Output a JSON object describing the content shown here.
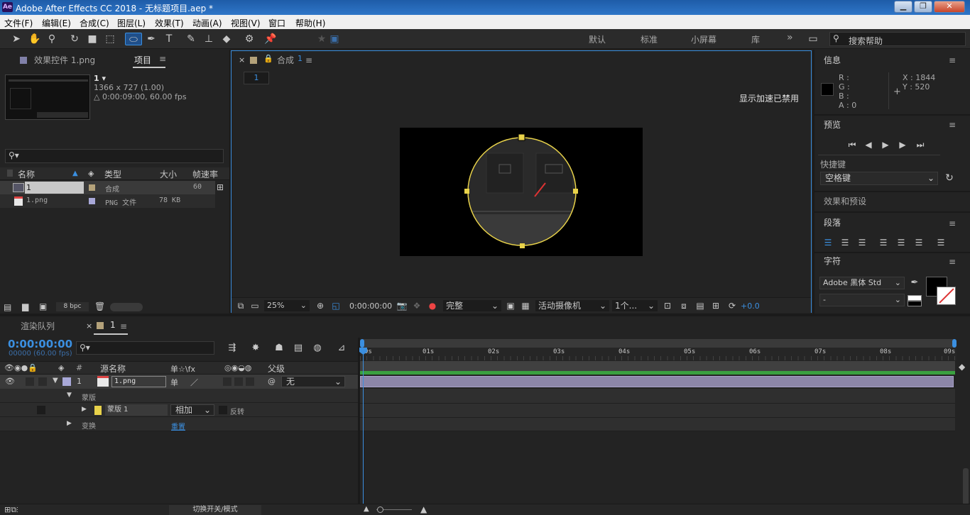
{
  "window": {
    "title": "Adobe After Effects CC 2018 - 无标题项目.aep *",
    "app_badge": "Ae",
    "min": "▁",
    "restore": "❐",
    "close": "✕"
  },
  "menu": [
    "文件(F)",
    "编辑(E)",
    "合成(C)",
    "图层(L)",
    "效果(T)",
    "动画(A)",
    "视图(V)",
    "窗口",
    "帮助(H)"
  ],
  "workspaces": {
    "default": "默认",
    "standard": "标准",
    "small_screen": "小屏幕",
    "library": "库",
    "more": "»"
  },
  "help_search": {
    "placeholder": "搜索帮助"
  },
  "project_panel": {
    "tab_effects": "效果控件 1.png",
    "tab_project": "项目",
    "comp_name": "1 ▾",
    "comp_size": "1366 x 727 (1.00)",
    "comp_duration": "△ 0:00:09:00, 60.00 fps",
    "search_placeholder": "",
    "columns": {
      "name": "名称",
      "type": "类型",
      "size": "大小",
      "fps": "帧速率"
    },
    "items": [
      {
        "name": "1",
        "type": "合成",
        "size": "",
        "fps": "60"
      },
      {
        "name": "1.png",
        "type": "PNG 文件",
        "size": "78 KB",
        "fps": ""
      }
    ],
    "bpc": "8 bpc"
  },
  "comp_panel": {
    "tab": "合成",
    "tab_num": "1",
    "sub_tab": "1",
    "notice": "显示加速已禁用",
    "zoom": "25%",
    "timecode": "0:00:00:00",
    "quality": "完整",
    "camera": "活动摄像机",
    "views": "1个...",
    "exposure": "+0.0"
  },
  "info_panel": {
    "title": "信息",
    "r": "R :",
    "g": "G :",
    "b": "B :",
    "a": "A : 0",
    "x": "X : 1844",
    "y": "Y : 520"
  },
  "preview_panel": {
    "title": "预览"
  },
  "shortcut_panel": {
    "title": "快捷键",
    "value": "空格键"
  },
  "effects_panel": {
    "title": "效果和预设"
  },
  "paragraph_panel": {
    "title": "段落"
  },
  "character_panel": {
    "title": "字符",
    "font": "Adobe 黑体 Std",
    "style": "-"
  },
  "render_tab": "渲染队列",
  "timeline": {
    "tab_num": "1",
    "timecode": "0:00:00:00",
    "frames": "00000 (60.00 fps)",
    "search_placeholder": "",
    "columns": {
      "num": "#",
      "source_name": "源名称",
      "parent": "父级"
    },
    "switch_icons": "单☆\\fx",
    "layer": {
      "num": "1",
      "name": "1.png",
      "parent": "无"
    },
    "mask_group": "蒙版",
    "mask": {
      "name": "蒙版 1",
      "mode": "相加",
      "invert": "反转"
    },
    "transform": {
      "label": "变换",
      "reset": "重置"
    },
    "toggle": "切换开关/模式",
    "ruler": [
      "0s",
      "01s",
      "02s",
      "03s",
      "04s",
      "05s",
      "06s",
      "07s",
      "08s",
      "09s"
    ]
  },
  "colors": {
    "accent": "#3b8fe0",
    "mask_yellow": "#e8d24a",
    "layer_bar": "#8c86a8",
    "work_area": "#3aa040"
  }
}
